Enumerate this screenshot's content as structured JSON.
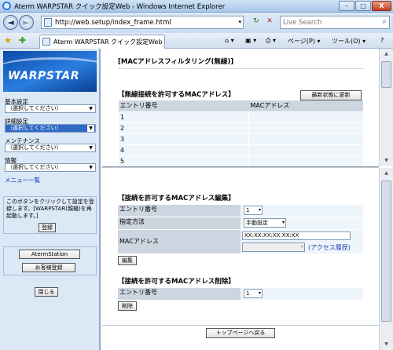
{
  "window": {
    "title": "Aterm WARPSTAR クイック設定Web - Windows Internet Explorer",
    "min": "–",
    "max": "□",
    "close": "X"
  },
  "address_bar": {
    "back": "◄",
    "forward": "►",
    "url": "http://web.setup/index_frame.html",
    "refresh": "↻",
    "stop": "✕",
    "search_placeholder": "Live Search"
  },
  "tabs": {
    "active_tab": "Aterm WARPSTAR クイック設定Web",
    "home": "⌂ ▾",
    "feeds": "▣ ▾",
    "print": "⎙ ▾",
    "page_menu": "ページ(P) ▾",
    "tools_menu": "ツール(O) ▾",
    "help": "?"
  },
  "sidebar": {
    "logo": "WARPSTAR",
    "groups": [
      {
        "label": "基本設定",
        "value": "（選択してください）",
        "selected": false
      },
      {
        "label": "詳細設定",
        "value": "（選択してください）",
        "selected": true
      },
      {
        "label": "メンテナンス",
        "value": "（選択してください）",
        "selected": false
      },
      {
        "label": "情報",
        "value": "（選択してください）",
        "selected": false
      }
    ],
    "menu_list_link": "メニュー一覧",
    "notice_text": "このボタンをクリックして設定を登録します。[WARPSTAR(親機)を再起動します。]",
    "register_button": "登録",
    "aterm_station_button": "AtermStation",
    "customer_register_button": "お客様登録",
    "close_button": "閉じる"
  },
  "main": {
    "page_title": "[MACアドレスフィルタリング(無線)]",
    "allowed_section": {
      "title": "【無線接続を許可するMACアドレス】",
      "refresh_button": "最新状態に更新",
      "columns": [
        "エントリ番号",
        "MACアドレス"
      ],
      "rows": [
        [
          "1",
          ""
        ],
        [
          "2",
          ""
        ],
        [
          "3",
          ""
        ],
        [
          "4",
          ""
        ],
        [
          "5",
          ""
        ]
      ]
    },
    "edit_section": {
      "title": "【接続を許可するMACアドレス編集】",
      "entry_label": "エントリ番号",
      "entry_value": "1",
      "method_label": "指定方法",
      "method_value": "手動設定",
      "mac_label": "MACアドレス",
      "mac_value": "XX:XX:XX:XX:XX:XX",
      "history_select": "",
      "history_link": "(アクセス履歴)",
      "edit_button": "編集"
    },
    "delete_section": {
      "title": "【接続を許可するMACアドレス削除】",
      "entry_label": "エントリ番号",
      "entry_value": "1",
      "delete_button": "削除"
    },
    "top_page_button": "トップページへ戻る"
  }
}
